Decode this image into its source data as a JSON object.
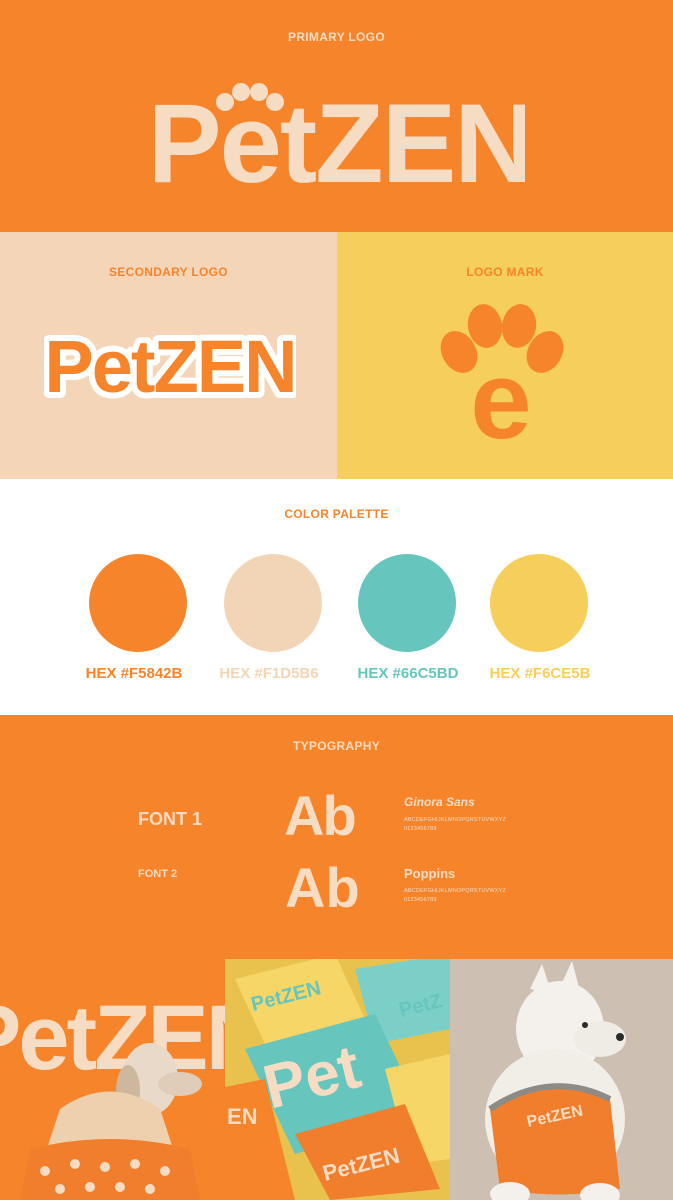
{
  "primary": {
    "label": "PRIMARY LOGO",
    "logo_text": "PetZEN"
  },
  "secondary": {
    "label": "SECONDARY LOGO",
    "logo_text": "PetZEN"
  },
  "mark": {
    "label": "LOGO MARK",
    "mark_letter": "e"
  },
  "palette": {
    "label": "COLOR PALETTE",
    "colors": [
      {
        "hex_label": "HEX #F5842B",
        "hex": "#F5842B"
      },
      {
        "hex_label": "HEX #F1D5B6",
        "hex": "#F1D5B6"
      },
      {
        "hex_label": "HEX #66C5BD",
        "hex": "#66C5BD"
      },
      {
        "hex_label": "HEX #F6CE5B",
        "hex": "#F6CE5B"
      }
    ]
  },
  "typography": {
    "label": "TYPOGRAPHY",
    "font1": {
      "name": "FONT 1",
      "sample": "Ab",
      "family": "Ginora Sans",
      "alphabet": "ABCDEFGHIJKLMNOPQRSTUVWXYZ",
      "digits": "0123456789"
    },
    "font2": {
      "name": "FONT 2",
      "sample": "Ab",
      "family": "Poppins",
      "alphabet": "ABCDEFGHIJKLMNOPQRSTUVWXYZ",
      "digits": "0123456789"
    }
  },
  "photos": {
    "photo1_text": "PetZEN",
    "photo2_text_top": "PetZEN",
    "photo2_text_center": "Pet",
    "photo2_text_right": "PetZ",
    "photo2_text_bottom": "PetZEN",
    "photo2_text_side": "EN",
    "photo3_text": "PetZEN"
  }
}
